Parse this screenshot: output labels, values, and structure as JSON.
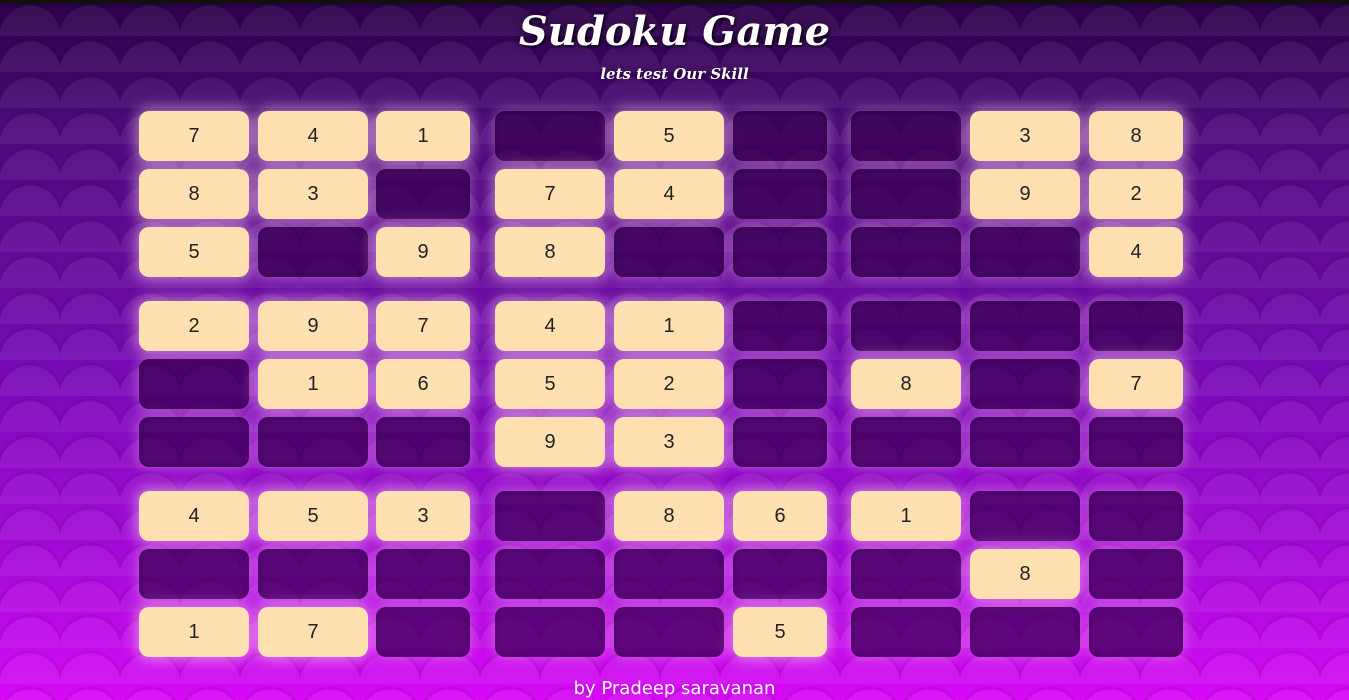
{
  "header": {
    "title": "Sudoku Game",
    "subtitle": "lets test Our Skill"
  },
  "board": {
    "rows": [
      [
        "7",
        "4",
        "1",
        "",
        "5",
        "",
        "",
        "3",
        "8"
      ],
      [
        "8",
        "3",
        "",
        "7",
        "4",
        "",
        "",
        "9",
        "2"
      ],
      [
        "5",
        "",
        "9",
        "8",
        "",
        "",
        "",
        "",
        "4"
      ],
      [
        "2",
        "9",
        "7",
        "4",
        "1",
        "",
        "",
        "",
        ""
      ],
      [
        "",
        "1",
        "6",
        "5",
        "2",
        "",
        "8",
        "",
        "7"
      ],
      [
        "",
        "",
        "",
        "9",
        "3",
        "",
        "",
        "",
        ""
      ],
      [
        "4",
        "5",
        "3",
        "",
        "8",
        "6",
        "1",
        "",
        ""
      ],
      [
        "",
        "",
        "",
        "",
        "",
        "",
        "",
        "8",
        ""
      ],
      [
        "1",
        "7",
        "",
        "",
        "",
        "5",
        "",
        "",
        ""
      ]
    ]
  },
  "footer": {
    "credit": "by Pradeep saravanan"
  },
  "colors": {
    "filled_cell": "#ffe0b0",
    "empty_cell": "#3a0055",
    "background_top": "#2c0048",
    "background_bottom": "#d70af5"
  }
}
